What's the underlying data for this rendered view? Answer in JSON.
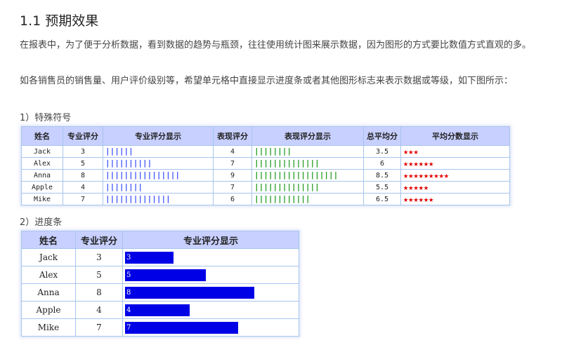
{
  "section_title": "1.1 预期效果",
  "para1": "在报表中，为了便于分析数据，看到数据的趋势与瓶颈，往往使用统计图来展示数据，因为图形的方式要比数值方式直观的多。",
  "para2": "如各销售员的销售量、用户评价级别等，希望单元格中直接显示进度条或者其他图形标志来表示数据或等级，如下图所示：",
  "heading1": "1）特殊符号",
  "heading2": "2）进度条",
  "table1": {
    "headers": [
      "姓名",
      "专业评分",
      "专业评分显示",
      "表现评分",
      "表现评分显示",
      "总平均分",
      "平均分数显示"
    ],
    "rows": [
      {
        "name": "Jack",
        "pro": "3",
        "pro_ticks": "||||||",
        "perf": "4",
        "perf_ticks": "||||||||",
        "avg": "3.5",
        "stars": "★★★"
      },
      {
        "name": "Alex",
        "pro": "5",
        "pro_ticks": "||||||||||",
        "perf": "7",
        "perf_ticks": "||||||||||||||",
        "avg": "6",
        "stars": "★★★★★★"
      },
      {
        "name": "Anna",
        "pro": "8",
        "pro_ticks": "||||||||||||||||",
        "perf": "9",
        "perf_ticks": "||||||||||||||||||",
        "avg": "8.5",
        "stars": "★★★★★★★★★"
      },
      {
        "name": "Apple",
        "pro": "4",
        "pro_ticks": "||||||||",
        "perf": "7",
        "perf_ticks": "||||||||||||||",
        "avg": "5.5",
        "stars": "★★★★★"
      },
      {
        "name": "Mike",
        "pro": "7",
        "pro_ticks": "||||||||||||||",
        "perf": "6",
        "perf_ticks": "||||||||||||",
        "avg": "6.5",
        "stars": "★★★★★★"
      }
    ]
  },
  "table2": {
    "headers": [
      "姓名",
      "专业评分",
      "专业评分显示"
    ],
    "bar_max": 10,
    "rows": [
      {
        "name": "Jack",
        "score": "3",
        "bar_value": 3
      },
      {
        "name": "Alex",
        "score": "5",
        "bar_value": 5
      },
      {
        "name": "Anna",
        "score": "8",
        "bar_value": 8
      },
      {
        "name": "Apple",
        "score": "4",
        "bar_value": 4
      },
      {
        "name": "Mike",
        "score": "7",
        "bar_value": 7
      }
    ]
  },
  "colors": {
    "header_bg": "#c8d0ff",
    "tick_blue": "#3a50ff",
    "tick_green": "#1c9a1c",
    "star_red": "#e00000",
    "bar_blue": "#0000e6"
  }
}
